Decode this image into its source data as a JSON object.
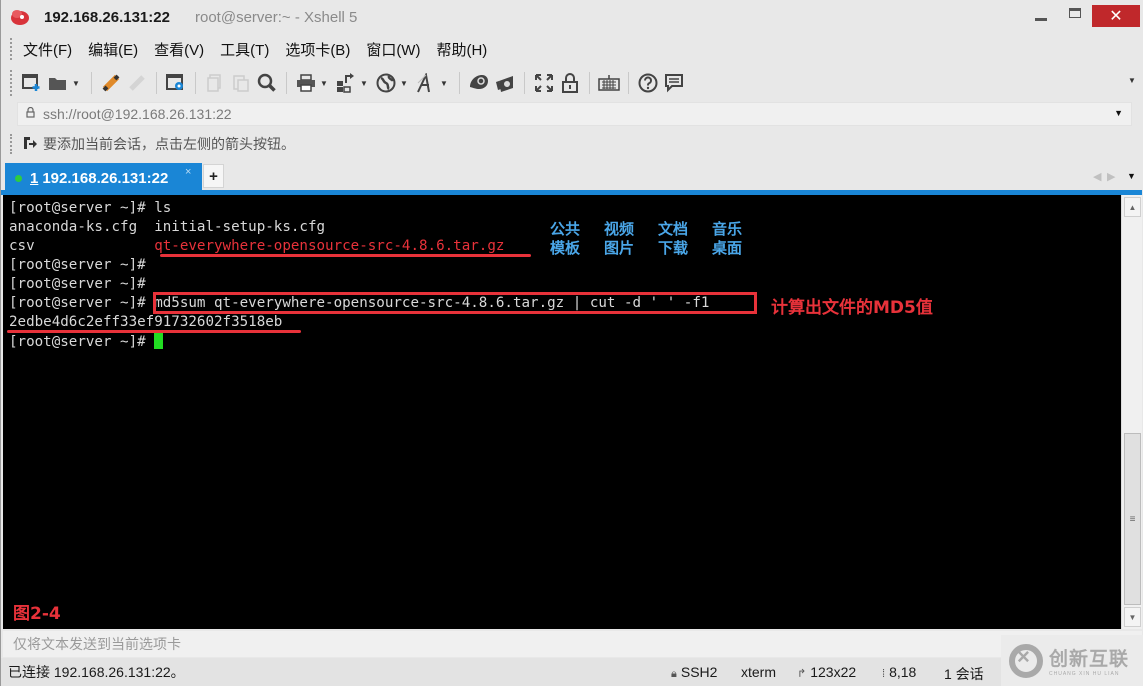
{
  "titlebar": {
    "host": "192.168.26.131:22",
    "subtitle": "root@server:~ - Xshell 5",
    "minimize_icon": "minimize-icon",
    "maximize_icon": "maximize-icon",
    "close_label": "✕"
  },
  "menu": {
    "items": [
      {
        "label": "文件(F)"
      },
      {
        "label": "编辑(E)"
      },
      {
        "label": "查看(V)"
      },
      {
        "label": "工具(T)"
      },
      {
        "label": "选项卡(B)"
      },
      {
        "label": "窗口(W)"
      },
      {
        "label": "帮助(H)"
      }
    ]
  },
  "toolbar": {
    "icons": [
      {
        "name": "new-session-icon",
        "glyph": "⧉"
      },
      {
        "name": "open-folder-icon",
        "glyph": "▬"
      },
      {
        "name": "connect-icon",
        "glyph": "✎"
      },
      {
        "name": "disconnect-icon",
        "glyph": "✎"
      },
      {
        "name": "properties-icon",
        "glyph": "⚙"
      },
      {
        "name": "copy-icon",
        "glyph": "❐"
      },
      {
        "name": "paste-icon",
        "glyph": "❐"
      },
      {
        "name": "find-icon",
        "glyph": "🔍"
      },
      {
        "name": "print-icon",
        "glyph": "⎙"
      },
      {
        "name": "transfer-icon",
        "glyph": "⇅"
      },
      {
        "name": "globe-icon",
        "glyph": "◍"
      },
      {
        "name": "font-icon",
        "glyph": "A"
      },
      {
        "name": "xftp-icon",
        "glyph": "◉"
      },
      {
        "name": "xmanager-icon",
        "glyph": "◐"
      },
      {
        "name": "fullscreen-icon",
        "glyph": "⛶"
      },
      {
        "name": "lock-icon",
        "glyph": "🔒"
      },
      {
        "name": "keyboard-icon",
        "glyph": "⌨"
      },
      {
        "name": "help-icon",
        "glyph": "?"
      },
      {
        "name": "chat-icon",
        "glyph": "💬"
      }
    ]
  },
  "address": {
    "value": "ssh://root@192.168.26.131:22"
  },
  "hint": {
    "text": "要添加当前会话，点击左侧的箭头按钮。"
  },
  "tabs": [
    {
      "number": "1",
      "label": "192.168.26.131:22",
      "active": true
    }
  ],
  "tab_add_label": "+",
  "terminal": {
    "lines": [
      {
        "prompt": "[root@server ~]# ",
        "text": "ls"
      },
      {
        "col1": "anaconda-ks.cfg  ",
        "col2": "initial-setup-ks.cfg"
      },
      {
        "col1": "csv              ",
        "col2": "qt-everywhere-opensource-src-4.8.6.tar.gz"
      },
      {
        "prompt": "[root@server ~]# ",
        "text": ""
      },
      {
        "prompt": "[root@server ~]# ",
        "text": ""
      },
      {
        "prompt": "[root@server ~]# ",
        "text": "md5sum qt-everywhere-opensource-src-4.8.6.tar.gz | cut -d ' ' -f1"
      },
      {
        "text": "2edbe4d6c2eff33ef91732602f3518eb"
      },
      {
        "prompt": "[root@server ~]# ",
        "text": ""
      }
    ],
    "dirs_row1": [
      "公共",
      "视频",
      "文档",
      "音乐"
    ],
    "dirs_row2": [
      "模板",
      "图片",
      "下载",
      "桌面"
    ],
    "annotation": "计算出文件的MD5值",
    "figure_label": "图2-4",
    "colors": {
      "highlight": "#e8323a",
      "dir": "#4aa6e8",
      "cursor": "#22dd22"
    }
  },
  "compose": {
    "placeholder": "仅将文本发送到当前选项卡"
  },
  "status": {
    "connection": "已连接 192.168.26.131:22。",
    "protocol": "SSH2",
    "terminal_type": "xterm",
    "size": "123x22",
    "cursor_pos": "8,18",
    "sessions": "1 会话"
  },
  "watermark": {
    "cn": "创新互联",
    "en": "CHUANG XIN HU LIAN"
  },
  "accent_color": "#1a86d6"
}
